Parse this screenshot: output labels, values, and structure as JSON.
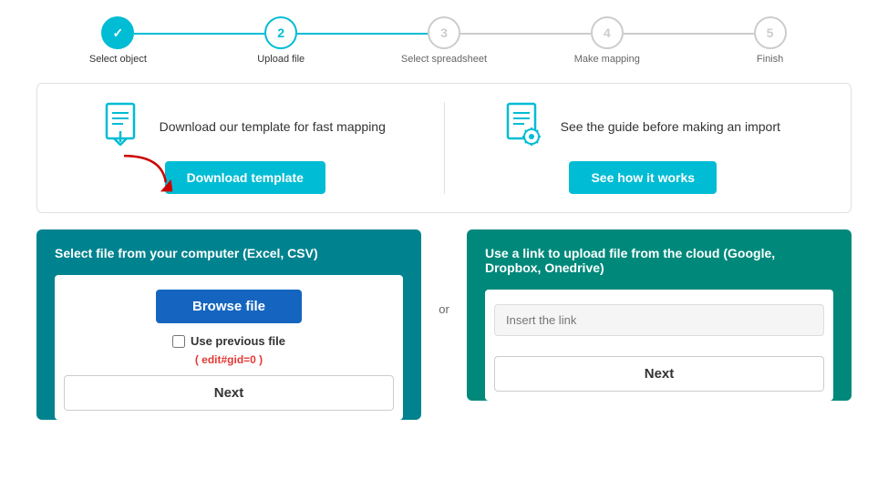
{
  "stepper": {
    "steps": [
      {
        "id": "select-object",
        "label": "Select object",
        "number": "✓",
        "state": "completed"
      },
      {
        "id": "upload-file",
        "label": "Upload file",
        "number": "2",
        "state": "active"
      },
      {
        "id": "select-spreadsheet",
        "label": "Select spreadsheet",
        "number": "3",
        "state": "inactive"
      },
      {
        "id": "make-mapping",
        "label": "Make mapping",
        "number": "4",
        "state": "inactive"
      },
      {
        "id": "finish",
        "label": "Finish",
        "number": "5",
        "state": "inactive"
      }
    ]
  },
  "info": {
    "card1": {
      "title": "Download our template for fast mapping",
      "button": "Download template"
    },
    "card2": {
      "title": "See the guide before making an import",
      "button": "See how it works"
    }
  },
  "upload": {
    "local_title": "Select file from your computer (Excel, CSV)",
    "browse_button": "Browse file",
    "use_previous_label": "Use previous file",
    "edit_link": "( edit#gid=0 )",
    "next_button": "Next",
    "or_label": "or"
  },
  "cloud": {
    "title": "Use a link to upload file from the cloud (Google, Dropbox, Onedrive)",
    "link_placeholder": "Insert the link",
    "next_button": "Next"
  }
}
